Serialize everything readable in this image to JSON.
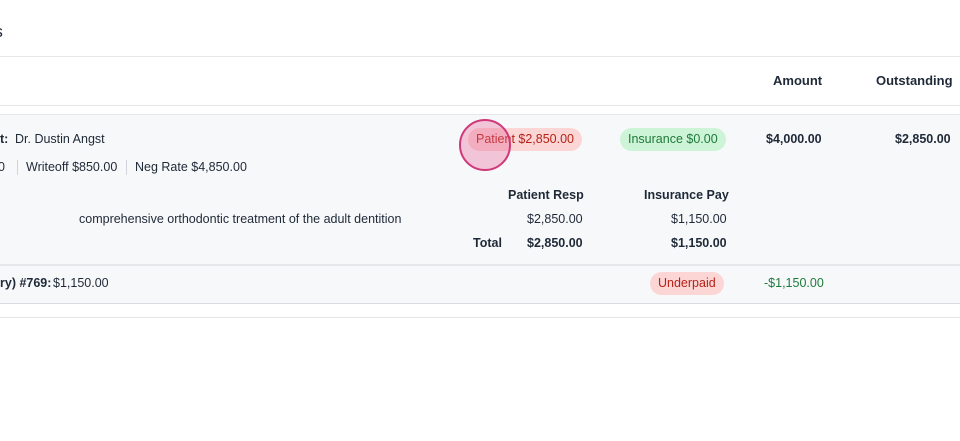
{
  "page": {
    "title_partial": "nts"
  },
  "table": {
    "headers": {
      "amount": "Amount",
      "outstanding": "Outstanding"
    }
  },
  "claim": {
    "provider_label": "t:",
    "provider_name": "Dr. Dustin Angst",
    "stats": {
      "first_partial": "0",
      "writeoff": "Writeoff $850.00",
      "neg_rate": "Neg Rate $4,850.00"
    },
    "patient_pill": "Patient $2,850.00",
    "insurance_pill": "Insurance $0.00",
    "amount": "$4,000.00",
    "outstanding": "$2,850.00",
    "detail": {
      "col_patient_resp": "Patient Resp",
      "col_insurance_pay": "Insurance Pay",
      "rows": [
        {
          "description": "comprehensive orthodontic treatment of the adult dentition",
          "patient_resp": "$2,850.00",
          "insurance_pay": "$1,150.00"
        }
      ],
      "total_label": "Total",
      "total_patient_resp": "$2,850.00",
      "total_insurance_pay": "$1,150.00"
    }
  },
  "payment": {
    "label_partial": "ry) #769:",
    "amount": "$1,150.00",
    "status": "Underpaid",
    "difference": "-$1,150.00"
  },
  "colors": {
    "pill_red_bg": "#fcd5d5",
    "pill_red_text": "#b42318",
    "pill_green_bg": "#cdf4d7",
    "pill_green_text": "#1e7a3a",
    "negative_value": "#1e7a3a",
    "panel_bg": "#f7f8fa"
  }
}
